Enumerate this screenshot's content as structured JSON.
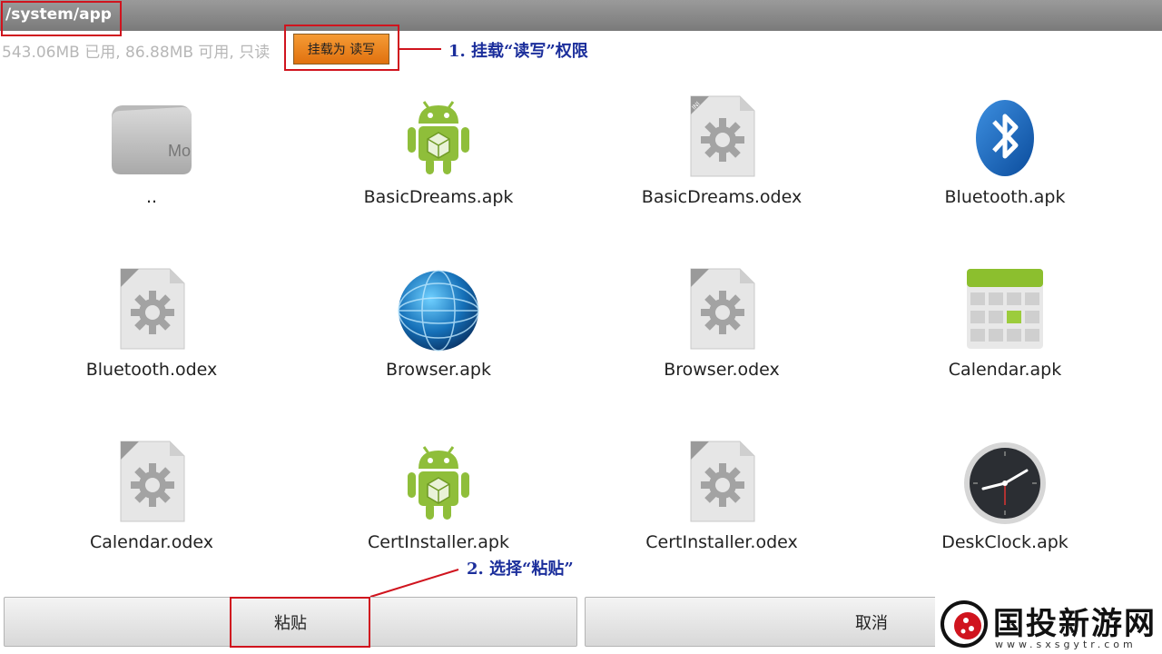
{
  "header": {
    "path": "/system/app",
    "storage_info": "543.06MB 已用, 86.88MB 可用, 只读",
    "mount_button_label": "挂载为 读写"
  },
  "annotations": {
    "step1": "1. 挂载“读写”权限",
    "step2": "2. 选择“粘贴”"
  },
  "files": [
    {
      "name": "..",
      "icon": "folder-icon"
    },
    {
      "name": "BasicDreams.apk",
      "icon": "android-icon"
    },
    {
      "name": "BasicDreams.odex",
      "icon": "ini-file-icon"
    },
    {
      "name": "Bluetooth.apk",
      "icon": "bluetooth-icon"
    },
    {
      "name": "Bluetooth.odex",
      "icon": "ini-file-icon"
    },
    {
      "name": "Browser.apk",
      "icon": "globe-icon"
    },
    {
      "name": "Browser.odex",
      "icon": "ini-file-icon"
    },
    {
      "name": "Calendar.apk",
      "icon": "calendar-icon"
    },
    {
      "name": "Calendar.odex",
      "icon": "ini-file-icon"
    },
    {
      "name": "CertInstaller.apk",
      "icon": "android-icon"
    },
    {
      "name": "CertInstaller.odex",
      "icon": "ini-file-icon"
    },
    {
      "name": "DeskClock.apk",
      "icon": "clock-icon"
    }
  ],
  "bottom_bar": {
    "paste_label": "粘贴",
    "cancel_label": "取消"
  },
  "watermark": {
    "text": "国投新游网",
    "sub": "www.sxsgytr.com"
  },
  "colors": {
    "title_bar": "#8a8a8a",
    "annotation_red": "#d0141e",
    "annotation_blue": "#1b2e9b",
    "mount_button": "#e8811f"
  }
}
